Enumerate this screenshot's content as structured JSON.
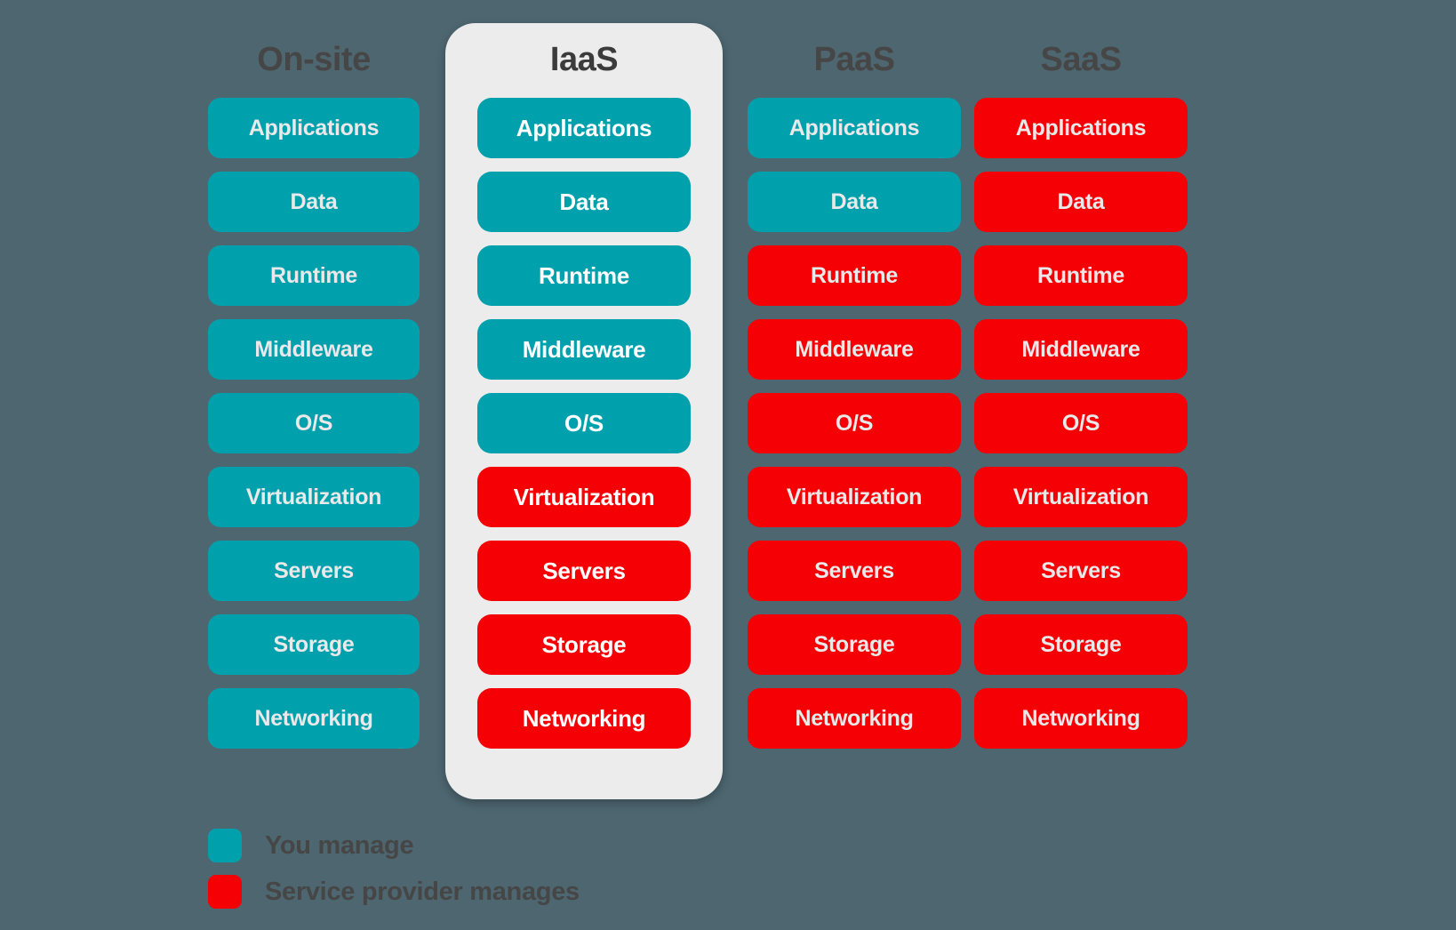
{
  "background_color": "#4d6670",
  "colors": {
    "manage": "#00a0ad",
    "provider": "#f50005",
    "highlight_card": "#ececec",
    "heading_text": "#464646"
  },
  "columns": [
    {
      "id": "on-site",
      "title": "On-site",
      "highlighted": false,
      "layers": [
        {
          "label": "Applications",
          "owner": "manage"
        },
        {
          "label": "Data",
          "owner": "manage"
        },
        {
          "label": "Runtime",
          "owner": "manage"
        },
        {
          "label": "Middleware",
          "owner": "manage"
        },
        {
          "label": "O/S",
          "owner": "manage"
        },
        {
          "label": "Virtualization",
          "owner": "manage"
        },
        {
          "label": "Servers",
          "owner": "manage"
        },
        {
          "label": "Storage",
          "owner": "manage"
        },
        {
          "label": "Networking",
          "owner": "manage"
        }
      ]
    },
    {
      "id": "iaas",
      "title": "IaaS",
      "highlighted": true,
      "layers": [
        {
          "label": "Applications",
          "owner": "manage"
        },
        {
          "label": "Data",
          "owner": "manage"
        },
        {
          "label": "Runtime",
          "owner": "manage"
        },
        {
          "label": "Middleware",
          "owner": "manage"
        },
        {
          "label": "O/S",
          "owner": "manage"
        },
        {
          "label": "Virtualization",
          "owner": "provider"
        },
        {
          "label": "Servers",
          "owner": "provider"
        },
        {
          "label": "Storage",
          "owner": "provider"
        },
        {
          "label": "Networking",
          "owner": "provider"
        }
      ]
    },
    {
      "id": "paas",
      "title": "PaaS",
      "highlighted": false,
      "layers": [
        {
          "label": "Applications",
          "owner": "manage"
        },
        {
          "label": "Data",
          "owner": "manage"
        },
        {
          "label": "Runtime",
          "owner": "provider"
        },
        {
          "label": "Middleware",
          "owner": "provider"
        },
        {
          "label": "O/S",
          "owner": "provider"
        },
        {
          "label": "Virtualization",
          "owner": "provider"
        },
        {
          "label": "Servers",
          "owner": "provider"
        },
        {
          "label": "Storage",
          "owner": "provider"
        },
        {
          "label": "Networking",
          "owner": "provider"
        }
      ]
    },
    {
      "id": "saas",
      "title": "SaaS",
      "highlighted": false,
      "layers": [
        {
          "label": "Applications",
          "owner": "provider"
        },
        {
          "label": "Data",
          "owner": "provider"
        },
        {
          "label": "Runtime",
          "owner": "provider"
        },
        {
          "label": "Middleware",
          "owner": "provider"
        },
        {
          "label": "O/S",
          "owner": "provider"
        },
        {
          "label": "Virtualization",
          "owner": "provider"
        },
        {
          "label": "Servers",
          "owner": "provider"
        },
        {
          "label": "Storage",
          "owner": "provider"
        },
        {
          "label": "Networking",
          "owner": "provider"
        }
      ]
    }
  ],
  "legend": [
    {
      "label": "You manage",
      "owner": "manage"
    },
    {
      "label": "Service provider manages",
      "owner": "provider"
    }
  ]
}
